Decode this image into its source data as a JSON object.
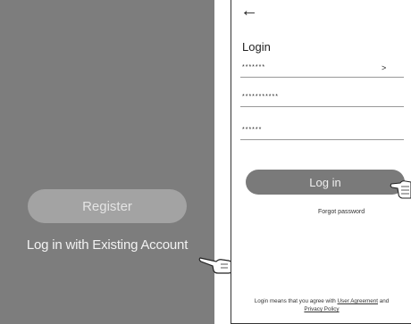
{
  "welcome": {
    "register_label": "Register",
    "existing_account_label": "Log in with Existing Account"
  },
  "login_screen": {
    "back_icon": "←",
    "title": "Login",
    "fields": [
      {
        "value": "*******",
        "has_chevron": true,
        "chevron": ">"
      },
      {
        "value": "***********"
      },
      {
        "value": "******"
      }
    ],
    "login_button_label": "Log in",
    "forgot_password_label": "Forgot password",
    "agreement_prefix": "Login means that you agree with",
    "user_agreement_label": "User Agreement",
    "agreement_and": " and",
    "privacy_policy_label": "Privacy Policy"
  },
  "icons": {
    "pointer_hand_left": "pointing-hand-icon",
    "pointer_hand_right": "pointing-hand-icon"
  },
  "colors": {
    "left_panel_bg": "#7d7d7d",
    "register_bg": "#a3a3a3",
    "login_button_bg": "#7a7a7a"
  }
}
